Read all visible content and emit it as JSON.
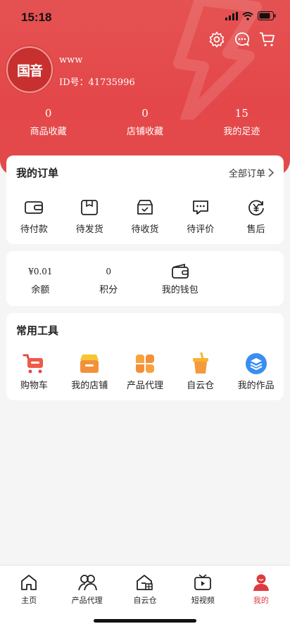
{
  "status": {
    "time": "15:18"
  },
  "profile": {
    "avatar_text": "国音",
    "username": "www",
    "id_label": "ID号：41735996"
  },
  "stats": [
    {
      "value": "0",
      "label": "商品收藏"
    },
    {
      "value": "0",
      "label": "店铺收藏"
    },
    {
      "value": "15",
      "label": "我的足迹"
    }
  ],
  "orders": {
    "title": "我的订单",
    "all_link": "全部订单",
    "items": [
      {
        "label": "待付款",
        "icon": "wallet-icon"
      },
      {
        "label": "待发货",
        "icon": "package-icon"
      },
      {
        "label": "待收货",
        "icon": "box-check-icon"
      },
      {
        "label": "待评价",
        "icon": "chat-icon"
      },
      {
        "label": "售后",
        "icon": "yen-refresh-icon"
      }
    ]
  },
  "wallet": {
    "balance_value": "¥0.01",
    "balance_label": "余额",
    "points_value": "0",
    "points_label": "积分",
    "wallet_label": "我的钱包"
  },
  "tools": {
    "title": "常用工具",
    "items": [
      {
        "label": "购物车",
        "icon": "cart-icon"
      },
      {
        "label": "我的店铺",
        "icon": "shop-icon"
      },
      {
        "label": "产品代理",
        "icon": "grid-flower-icon"
      },
      {
        "label": "自云仓",
        "icon": "cup-icon"
      },
      {
        "label": "我的作品",
        "icon": "layers-icon"
      }
    ]
  },
  "tabbar": [
    {
      "label": "主页",
      "icon": "home-icon"
    },
    {
      "label": "产品代理",
      "icon": "people-icon"
    },
    {
      "label": "自云仓",
      "icon": "warehouse-icon"
    },
    {
      "label": "短视频",
      "icon": "tv-play-icon"
    },
    {
      "label": "我的",
      "icon": "user-icon"
    }
  ],
  "colors": {
    "brand_red": "#e4474a",
    "active_tab": "#e03a3e",
    "tool_orange": "#f39a3c",
    "tool_blue": "#3a8ef0"
  }
}
